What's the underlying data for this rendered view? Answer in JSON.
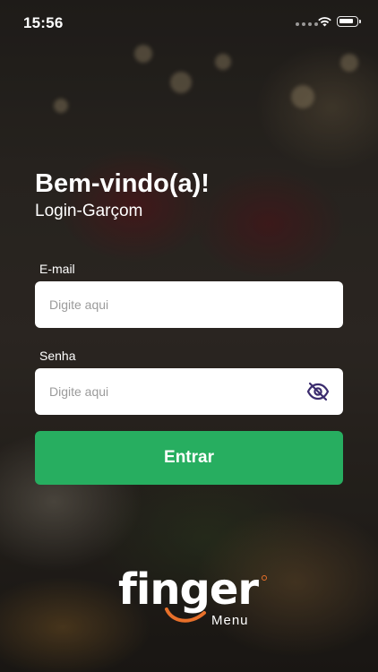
{
  "status_bar": {
    "time": "15:56"
  },
  "header": {
    "title": "Bem-vindo(a)!",
    "subtitle": "Login-Garçom"
  },
  "form": {
    "email_label": "E-mail",
    "email_placeholder": "Digite aqui",
    "password_label": "Senha",
    "password_placeholder": "Digite aqui",
    "submit_label": "Entrar"
  },
  "brand": {
    "name": "finger",
    "sub": "Menu"
  },
  "colors": {
    "accent": "#27ae60",
    "brand_orange": "#e8702a",
    "eye_icon": "#3b2c6e"
  },
  "icons": {
    "password_toggle": "eye-off-icon"
  }
}
